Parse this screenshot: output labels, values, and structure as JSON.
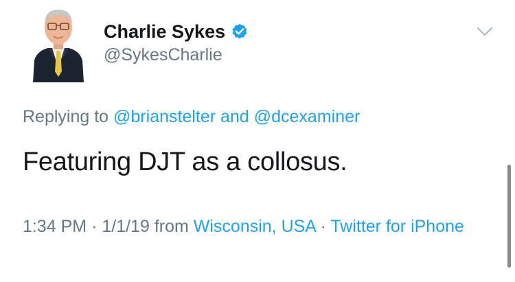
{
  "tweet": {
    "author": {
      "display_name": "Charlie Sykes",
      "handle": "@SykesCharlie",
      "verified": true,
      "avatar_icon": "profile-photo"
    },
    "reply": {
      "prefix": "Replying to",
      "users": [
        "@brianstelter",
        "@dcexaminer"
      ],
      "joiner": "and"
    },
    "text": "Featuring DJT as a collosus.",
    "meta": {
      "time": "1:34 PM",
      "separator": "·",
      "date": "1/1/19",
      "from_label": "from",
      "location": "Wisconsin, USA",
      "source": "Twitter for iPhone"
    },
    "menu_icon": "chevron-down-icon"
  },
  "colors": {
    "link": "#1da1f2",
    "muted": "#657786",
    "text": "#14171a",
    "verified_badge": "#1da1f2"
  }
}
